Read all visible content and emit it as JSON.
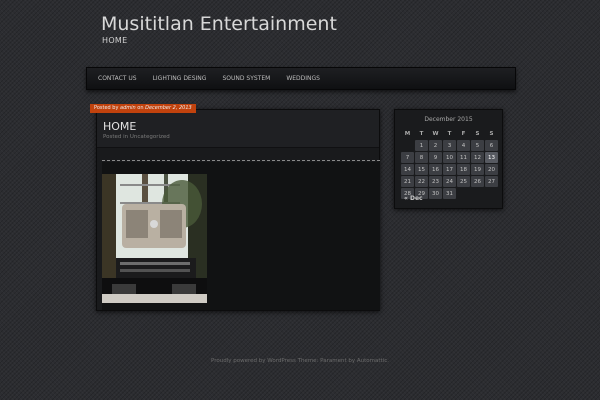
{
  "site": {
    "title": "Musititlan Entertainment",
    "description": "HOME"
  },
  "nav": {
    "items": [
      {
        "label": "CONTACT US"
      },
      {
        "label": "LIGHTING DESING"
      },
      {
        "label": "SOUND SYSTEM"
      },
      {
        "label": "WEDDINGS"
      }
    ]
  },
  "post": {
    "date_prefix": "Posted by",
    "author": "admin",
    "date_connector": "on",
    "date": "December 2, 2013",
    "title": "HOME",
    "meta": "Posted in Uncategorized"
  },
  "calendar": {
    "caption": "December 2015",
    "headers": [
      "M",
      "T",
      "W",
      "T",
      "F",
      "S",
      "S"
    ],
    "weeks": [
      [
        "",
        "1",
        "2",
        "3",
        "4",
        "5",
        "6"
      ],
      [
        "7",
        "8",
        "9",
        "10",
        "11",
        "12",
        "13"
      ],
      [
        "14",
        "15",
        "16",
        "17",
        "18",
        "19",
        "20"
      ],
      [
        "21",
        "22",
        "23",
        "24",
        "25",
        "26",
        "27"
      ],
      [
        "28",
        "29",
        "30",
        "31",
        "",
        "",
        ""
      ]
    ],
    "today": "13",
    "prev_label": "« Dec"
  },
  "footer": {
    "text": "Proudly powered by WordPress Theme: Parament by Automattic."
  },
  "colors": {
    "accent": "#c1420d",
    "background": "#2c2d31",
    "panel": "#191a1c"
  }
}
